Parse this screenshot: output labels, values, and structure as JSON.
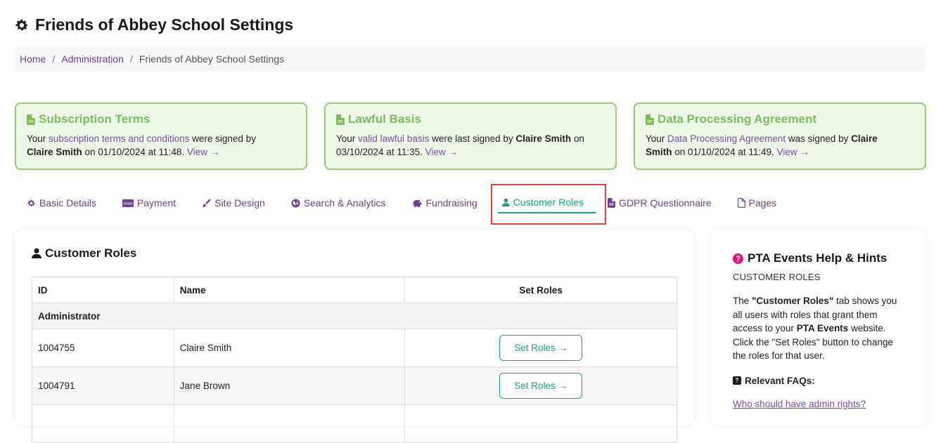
{
  "page": {
    "title": "Friends of Abbey School Settings"
  },
  "breadcrumb": {
    "home": "Home",
    "sep1": "/",
    "admin": "Administration",
    "sep2": "/",
    "current": "Friends of Abbey School Settings"
  },
  "cards": [
    {
      "title": "Subscription Terms",
      "prefix": "Your ",
      "link": "subscription terms and conditions",
      "mid": " were signed by",
      "signer": "Claire Smith",
      "suffix": " on 01/10/2024 at 11:48. ",
      "view": "View →"
    },
    {
      "title": "Lawful Basis",
      "prefix": "Your ",
      "link": "valid lawful basis",
      "mid": " were last signed by ",
      "signer": "Claire Smith",
      "suffix": " on 03/10/2024 at 11:35. ",
      "view": "View →"
    },
    {
      "title": "Data Processing Agreement",
      "prefix": "Your ",
      "link": "Data Processing Agreement",
      "mid": " was signed by ",
      "signer": "Claire Smith",
      "suffix": " on 01/10/2024 at 11:49. ",
      "view": "View →"
    }
  ],
  "tabs": [
    {
      "label": "Basic Details",
      "icon": "gear-icon"
    },
    {
      "label": "Payment",
      "icon": "stripe-icon"
    },
    {
      "label": "Site Design",
      "icon": "brush-icon"
    },
    {
      "label": "Search & Analytics",
      "icon": "globe-icon"
    },
    {
      "label": "Fundraising",
      "icon": "piggy-bank-icon"
    },
    {
      "label": "Customer Roles",
      "icon": "user-icon",
      "active": true
    },
    {
      "label": "GDPR Questionnaire",
      "icon": "document-icon"
    },
    {
      "label": "Pages",
      "icon": "file-icon"
    }
  ],
  "colors": {
    "accent_green": "#14a38a",
    "link_purple": "#6f3f8f",
    "card_border": "#96cc7b",
    "card_title": "#7dbb5c",
    "highlight_red": "#e0453d",
    "help_icon": "#e0177a"
  },
  "roles_panel": {
    "title": "Customer Roles",
    "columns": [
      "ID",
      "Name",
      "Set Roles"
    ],
    "group": "Administrator",
    "rows": [
      {
        "id": "1004755",
        "name": "Claire Smith",
        "button": "Set Roles →"
      },
      {
        "id": "1004791",
        "name": "Jane Brown",
        "button": "Set Roles →"
      }
    ]
  },
  "help": {
    "title": "PTA Events Help & Hints",
    "subtitle": "CUSTOMER ROLES",
    "text_1": "The ",
    "text_bold_1": "\"Customer Roles\"",
    "text_2": " tab shows you all users with roles that grant them access to your ",
    "text_bold_2": "PTA Events",
    "text_3": " website. Click the \"Set Roles\" button to change the roles for that user.",
    "faq_title": "Relevant FAQs:",
    "faq_link": "Who should have admin rights?"
  }
}
